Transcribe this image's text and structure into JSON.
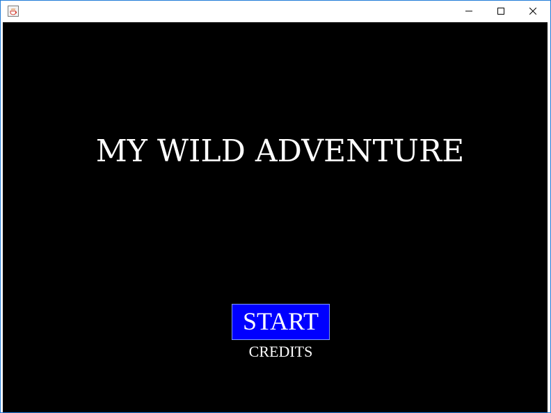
{
  "window": {
    "title": "",
    "controls": {
      "minimize_icon": "minimize-icon",
      "maximize_icon": "maximize-icon",
      "close_icon": "close-icon"
    },
    "app_icon": "java-coffee-cup-icon"
  },
  "game": {
    "title": "MY WILD ADVENTURE",
    "start_label": "START",
    "credits_label": "CREDITS",
    "colors": {
      "background": "#000000",
      "text": "#ffffff",
      "start_button": "#0000ff"
    }
  }
}
